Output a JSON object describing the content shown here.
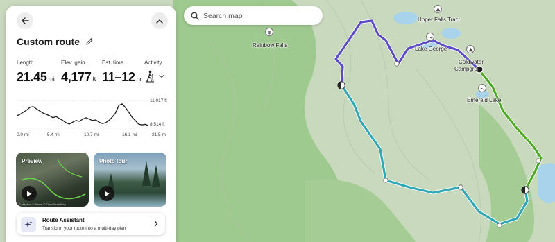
{
  "panel": {
    "title": "Custom route",
    "stats": {
      "length": {
        "label": "Length",
        "value": "21.45",
        "unit": "mi"
      },
      "elev_gain": {
        "label": "Elev. gain",
        "value": "4,177",
        "unit": "ft"
      },
      "est_time": {
        "label": "Est. time",
        "value": "11–12",
        "unit": "hr"
      },
      "activity": {
        "label": "Activity",
        "icon": "hiker-icon"
      }
    },
    "elevation": {
      "max_label": "11,017 ft",
      "min_label": "8,514 ft",
      "distance_ticks": [
        "0.0 mi",
        "5.4 mi",
        "10.7 mi",
        "16.1 mi",
        "21.5 mi"
      ],
      "profile": [
        0.55,
        0.5,
        0.42,
        0.35,
        0.25,
        0.22,
        0.3,
        0.38,
        0.45,
        0.5,
        0.55,
        0.62,
        0.58,
        0.65,
        0.72,
        0.8,
        0.85,
        0.78,
        0.72,
        0.75,
        0.68,
        0.62,
        0.67,
        0.72,
        0.7,
        0.78,
        0.83,
        0.8,
        0.72,
        0.6,
        0.45,
        0.18,
        0.12,
        0.25,
        0.42,
        0.6,
        0.72,
        0.85,
        0.88,
        0.86,
        0.9
      ]
    },
    "thumbnails": [
      {
        "label": "Preview",
        "credit": "© Mapbox © Maxar © OpenStreetMap"
      },
      {
        "label": "Photo tour"
      }
    ],
    "assistant": {
      "title": "Route Assistant",
      "subtitle": "Transform your route into a multi-day plan"
    }
  },
  "search": {
    "placeholder": "Search map"
  },
  "map_labels": {
    "rainbow_falls": "Rainbow Falls",
    "upper_falls": "Upper Falls Tract",
    "lake_george": "Lake George",
    "coldwater": "Coldwater",
    "campground": "Campgro",
    "emerald_lake": "Emerald Lake"
  },
  "colors": {
    "route_purple": "#5b4bc9",
    "route_teal": "#2fa7b5",
    "route_green": "#4aa822",
    "terrain": "#c9d9bd",
    "forest": "#9ec98f",
    "lake": "#a9d3ea"
  }
}
